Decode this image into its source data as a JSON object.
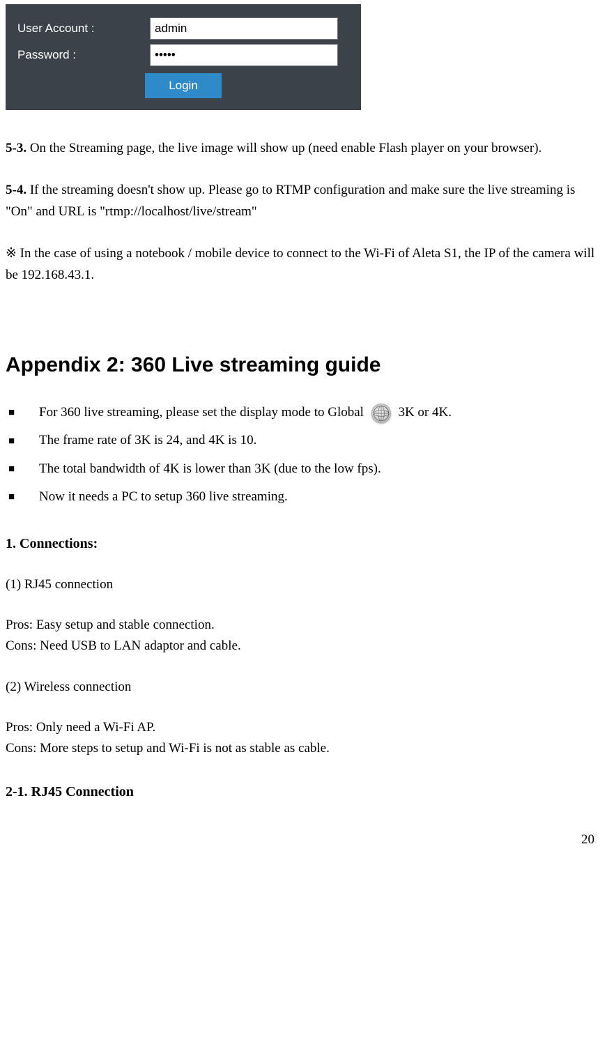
{
  "login": {
    "user_label": "User Account   :",
    "password_label": "Password           :",
    "user_value": "admin",
    "password_value": "•••••",
    "button_label": "Login"
  },
  "paragraphs": {
    "p53_label": "5-3.",
    "p53_text": " On the Streaming page, the live image will show up (need enable Flash player on your browser).",
    "p54_label": "5-4.",
    "p54_text": " If the streaming doesn't show up. Please go to RTMP configuration and make sure the live streaming is \"On\" and URL is \"rtmp://localhost/live/stream\"",
    "note": "※  In the case of using a notebook / mobile device to connect to the Wi-Fi of Aleta S1, the IP of the camera will be 192.168.43.1."
  },
  "appendix": {
    "heading": "Appendix 2: 360 Live streaming guide",
    "bullets": [
      {
        "pre": "For 360 live streaming, please set the display mode to Global ",
        "post": "  3K or 4K."
      },
      {
        "text": "The frame rate of 3K is 24, and 4K is 10."
      },
      {
        "text": "The total bandwidth of 4K is lower than 3K (due to the low fps)."
      },
      {
        "text": "Now it needs a PC to setup 360 live streaming."
      }
    ],
    "connections_heading": "1. Connections:",
    "conn1_label": "(1) RJ45 connection",
    "conn1_pros": "Pros: Easy setup and stable connection.",
    "conn1_cons": "Cons: Need USB to LAN adaptor and cable.",
    "conn2_label": "(2) Wireless connection",
    "conn2_pros": "Pros: Only need a Wi-Fi AP.",
    "conn2_cons": "Cons: More steps to setup and Wi-Fi is not as stable as cable.",
    "rj45_heading": "2-1. RJ45 Connection"
  },
  "page_number": "20"
}
